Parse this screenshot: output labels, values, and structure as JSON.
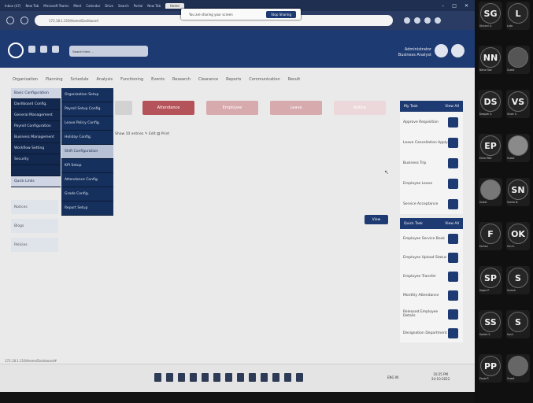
{
  "browser": {
    "tabs": [
      "Inbox (47)",
      "New Tab",
      "Microsoft Teams",
      "Meet",
      "Calendar",
      "Drive",
      "Search",
      "Portal",
      "New Tab",
      "Home"
    ],
    "active_tab": "Home",
    "url": "172.18.1.219/Home/Dashboard",
    "window_controls": [
      "–",
      "□",
      "✕"
    ]
  },
  "app": {
    "search_value": "Search Here ...",
    "user_name": "Administrator",
    "user_role": "Business Analyst",
    "toast_text": "You are sharing your screen",
    "toast_button": "Stop Sharing"
  },
  "menu": [
    "Organization",
    "Planning",
    "Schedule",
    "Analysis",
    "Functioning",
    "Events",
    "Research",
    "Clearance",
    "Reports",
    "Communication",
    "Result"
  ],
  "buttons": [
    "",
    "Attendance",
    "Employee",
    "Leave",
    "Notice"
  ],
  "filter_text": "Show 10 entries   ✎ Edit   ▤ Print",
  "view_button": "View",
  "dropdown1": [
    {
      "label": "Basic Configuration",
      "active": true
    },
    {
      "label": "Dashboard Config.",
      "active": false
    },
    {
      "label": "General Management",
      "active": false
    },
    {
      "label": "Payroll Configuration",
      "active": false
    },
    {
      "label": "Business Management",
      "active": false
    },
    {
      "label": "Workflow Setting",
      "active": false
    },
    {
      "label": "Security",
      "active": false
    },
    {
      "label": "",
      "active": false
    },
    {
      "label": "Quick Links",
      "active": true
    }
  ],
  "dropdown2": [
    {
      "label": "Organization Setup",
      "active": false
    },
    {
      "label": "Payroll Setup Config.",
      "active": false
    },
    {
      "label": "Leave Policy Config.",
      "active": false
    },
    {
      "label": "Holiday Config.",
      "active": false
    },
    {
      "label": "Shift Configuration",
      "active": true
    },
    {
      "label": "KPI Setup",
      "active": false
    },
    {
      "label": "Attendance Config.",
      "active": false
    },
    {
      "label": "Grade Config.",
      "active": false
    },
    {
      "label": "Report Setup",
      "active": false
    }
  ],
  "left_links": [
    "Notices",
    "Blogs",
    "Policies"
  ],
  "right_panel_1": {
    "title": "My Task",
    "action": "View All",
    "items": [
      "Approve Requisition",
      "Leave Cancellation Apply",
      "Business Trip",
      "Employee Leave",
      "Service Acceptance"
    ]
  },
  "right_panel_2": {
    "title": "Quick Task",
    "action": "View All",
    "items": [
      "Employee Service Book",
      "Employee Upload Status",
      "Employee Transfer",
      "Monthly Attendance",
      "Released Employee Details",
      "Designation Department"
    ]
  },
  "status_url": "172.18.1.219/Home/Dashboard#",
  "taskbar": {
    "tray_text": "ENG  IN",
    "time": "10:25 PM",
    "date": "24-10-2022"
  },
  "participants": [
    {
      "initials": "SG",
      "name": "Shivani G."
    },
    {
      "initials": "L",
      "name": "Lata"
    },
    {
      "initials": "NN",
      "name": "Neha Nair"
    },
    {
      "initials": "",
      "name": "Guest"
    },
    {
      "initials": "DS",
      "name": "Deepak S."
    },
    {
      "initials": "VS",
      "name": "Vivek S."
    },
    {
      "initials": "EP",
      "name": "Esha Patil"
    },
    {
      "initials": "",
      "name": "Guest"
    },
    {
      "initials": "",
      "name": "Guest"
    },
    {
      "initials": "SN",
      "name": "Sneha N."
    },
    {
      "initials": "F",
      "name": "Farhan"
    },
    {
      "initials": "OK",
      "name": "Om K."
    },
    {
      "initials": "SP",
      "name": "Sagar P."
    },
    {
      "initials": "S",
      "name": "Suresh"
    },
    {
      "initials": "SS",
      "name": "Sakshi S."
    },
    {
      "initials": "S",
      "name": "Sunil"
    },
    {
      "initials": "PP",
      "name": "Pooja P."
    },
    {
      "initials": "",
      "name": "Guest"
    }
  ]
}
